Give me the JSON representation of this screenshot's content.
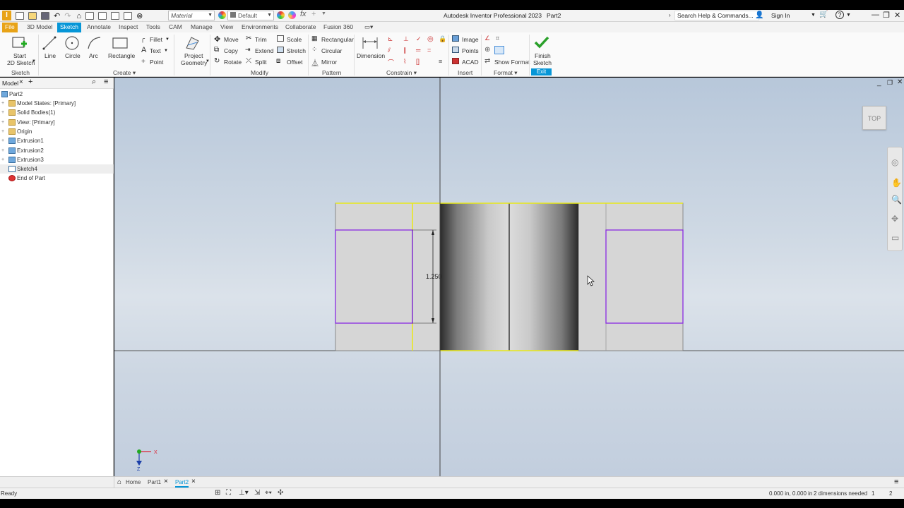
{
  "titlebar": {
    "app_title": "Autodesk Inventor Professional 2023",
    "doc_name": "Part2",
    "material_select": "Material",
    "appearance_select": "Default",
    "help_search_placeholder": "Search Help & Commands...",
    "sign_in": "Sign In"
  },
  "tabs": [
    "File",
    "3D Model",
    "Sketch",
    "Annotate",
    "Inspect",
    "Tools",
    "CAM",
    "Manage",
    "View",
    "Environments",
    "Collaborate",
    "Fusion 360"
  ],
  "active_tab": "Sketch",
  "ribbon": {
    "sketch_group": {
      "start_2d_sketch_line1": "Start",
      "start_2d_sketch_line2": "2D Sketch",
      "label": "Sketch"
    },
    "create_group": {
      "line": "Line",
      "circle": "Circle",
      "arc": "Arc",
      "rectangle": "Rectangle",
      "fillet": "Fillet",
      "text": "Text",
      "point": "Point",
      "label": "Create"
    },
    "project_geometry_line1": "Project",
    "project_geometry_line2": "Geometry",
    "modify_group": {
      "move": "Move",
      "copy": "Copy",
      "rotate": "Rotate",
      "trim": "Trim",
      "extend": "Extend",
      "split": "Split",
      "scale": "Scale",
      "stretch": "Stretch",
      "offset": "Offset",
      "label": "Modify"
    },
    "pattern_group": {
      "rectangular": "Rectangular",
      "circular": "Circular",
      "mirror": "Mirror",
      "label": "Pattern"
    },
    "constrain_group": {
      "dimension": "Dimension",
      "label": "Constrain"
    },
    "insert_group": {
      "image": "Image",
      "points": "Points",
      "acad": "ACAD",
      "label": "Insert"
    },
    "format_group": {
      "show_format": "Show Format",
      "label": "Format"
    },
    "exit_group": {
      "finish_line1": "Finish",
      "finish_line2": "Sketch",
      "label": "Exit"
    }
  },
  "browser": {
    "tab_label": "Model",
    "root": "Part2",
    "items": [
      {
        "label": "Model States: [Primary]",
        "icon": "folder-icon"
      },
      {
        "label": "Solid Bodies(1)",
        "icon": "folder-icon"
      },
      {
        "label": "View: [Primary]",
        "icon": "folder-icon"
      },
      {
        "label": "Origin",
        "icon": "folder-icon"
      },
      {
        "label": "Extrusion1",
        "icon": "extrusion-icon"
      },
      {
        "label": "Extrusion2",
        "icon": "extrusion-icon"
      },
      {
        "label": "Extrusion3",
        "icon": "extrusion-icon"
      },
      {
        "label": "Sketch4",
        "icon": "sketch-icon"
      },
      {
        "label": "End of Part",
        "icon": "end-of-part-icon"
      }
    ]
  },
  "viewport": {
    "viewcube_label": "TOP",
    "dimension_value": "1.250",
    "axis_x": "X",
    "axis_z": "Z",
    "colors": {
      "sketch_purple": "#8a2be2",
      "projected_yellow": "#e8e818",
      "edge": "#111111"
    }
  },
  "doc_tabs": {
    "home": "Home",
    "part1": "Part1",
    "part2": "Part2"
  },
  "statusbar": {
    "status": "Ready",
    "coords": "0.000 in, 0.000 in",
    "dims_needed": "2 dimensions needed",
    "count1": "1",
    "count2": "2"
  }
}
